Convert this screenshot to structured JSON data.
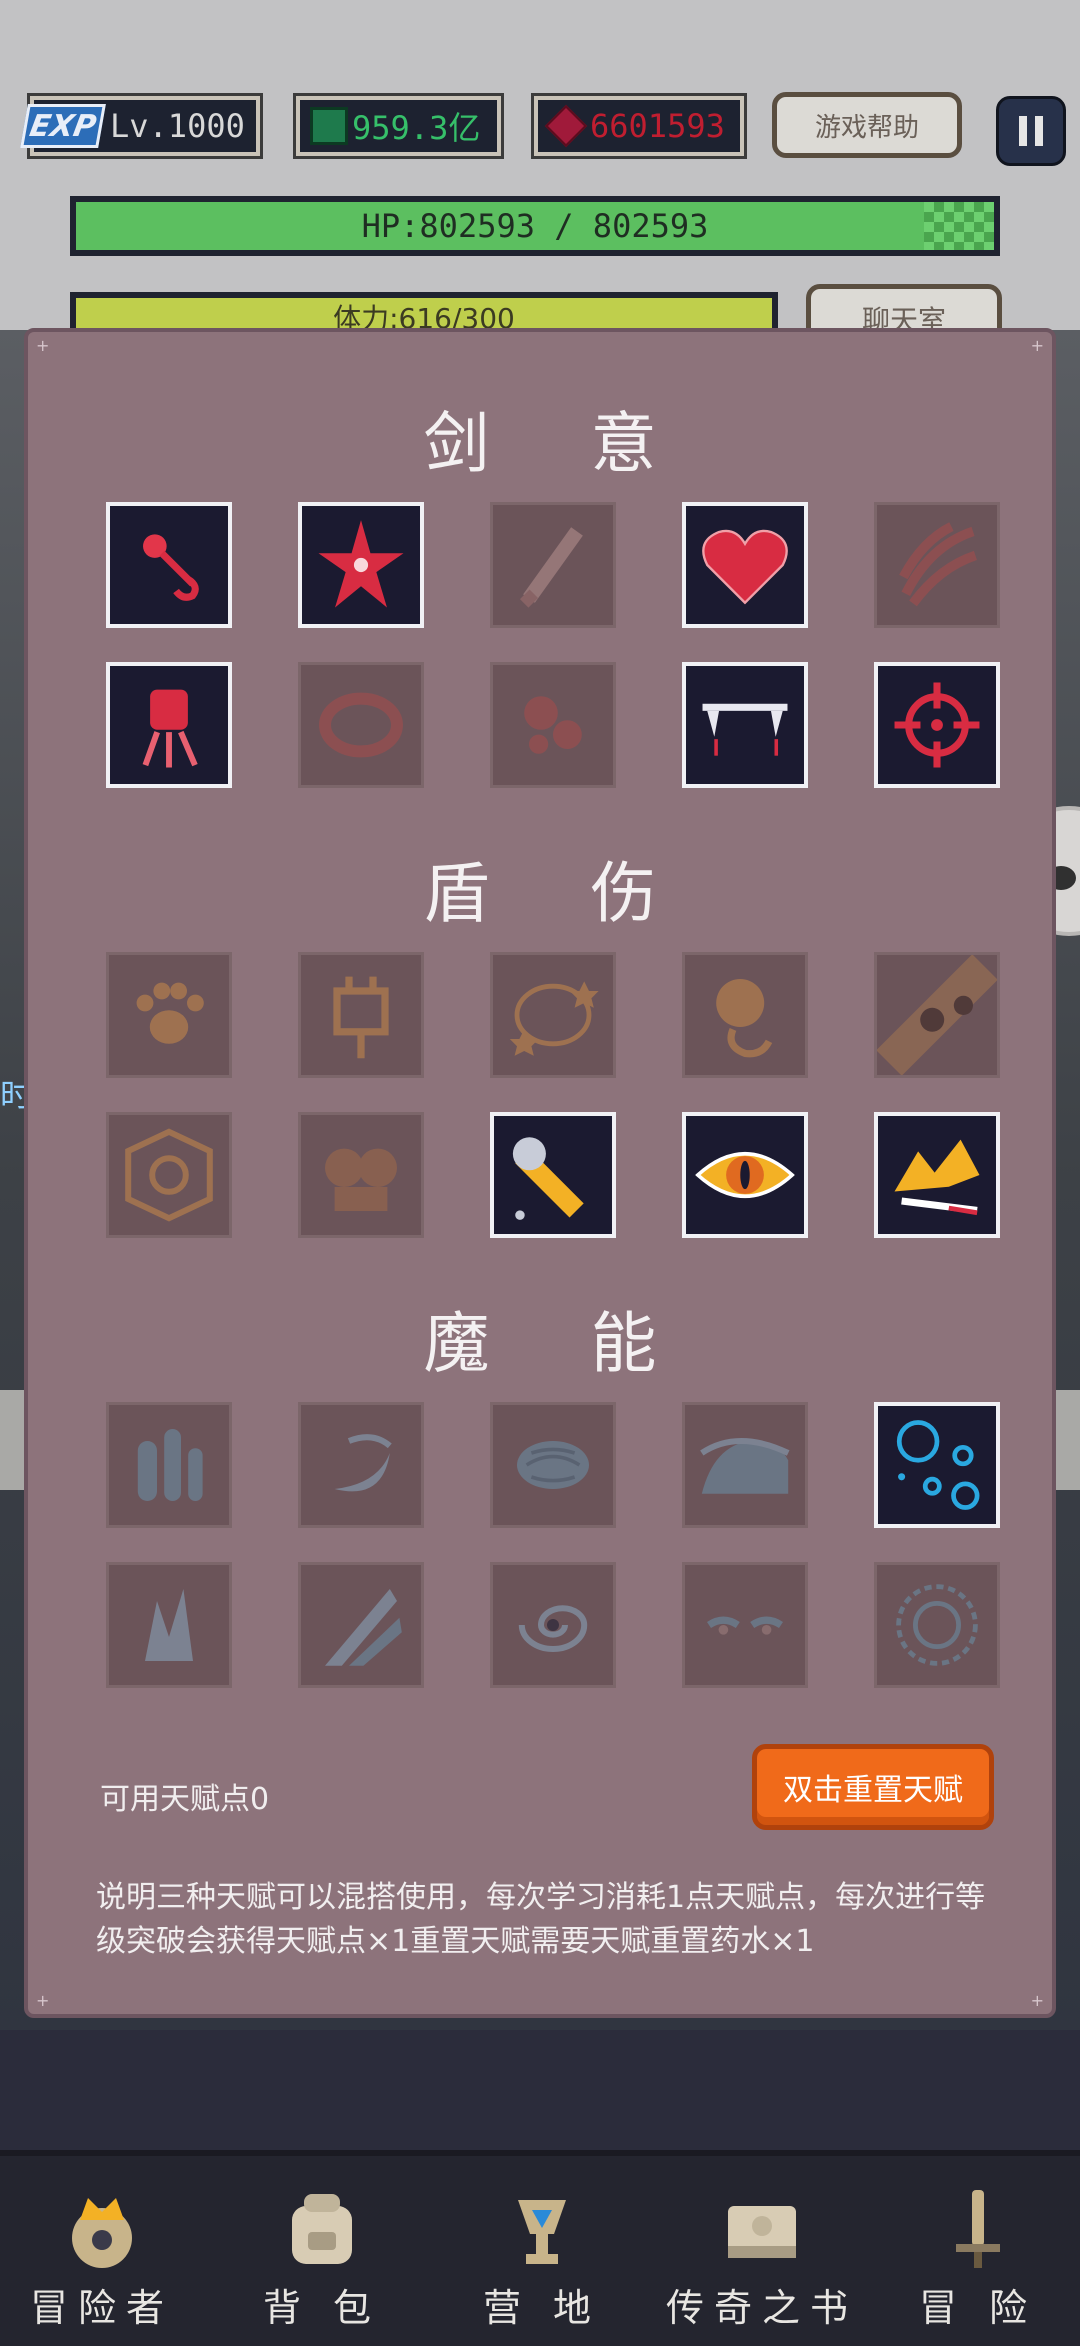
{
  "hud": {
    "exp_logo": "EXP",
    "level": "Lv.1000",
    "gems": "959.3亿",
    "rubies": "6601593",
    "help_button": "游戏帮助",
    "hp": "HP:802593 / 802593",
    "stamina": "体力:616/300",
    "chat_button": "聊天室"
  },
  "sections": [
    {
      "title": "剑 意"
    },
    {
      "title": "盾 伤"
    },
    {
      "title": "魔 能"
    }
  ],
  "talent_points_label": "可用天赋点0",
  "reset_button": "双击重置天赋",
  "description": "说明三种天赋可以混搭使用，每次学习消耗1点天赋点，每次进行等级突破会获得天赋点×1重置天赋需要天赋重置药水×1",
  "side_text": "时",
  "nav": {
    "items": [
      {
        "label": "冒险者"
      },
      {
        "label": "背 包"
      },
      {
        "label": "营 地"
      },
      {
        "label": "传奇之书"
      },
      {
        "label": "冒 险"
      }
    ]
  },
  "colors": {
    "panel": "#8d737b",
    "reset_button": "#f06a1a",
    "hp_bar": "#5cbf60",
    "stamina_bar": "#bfcf4c"
  }
}
